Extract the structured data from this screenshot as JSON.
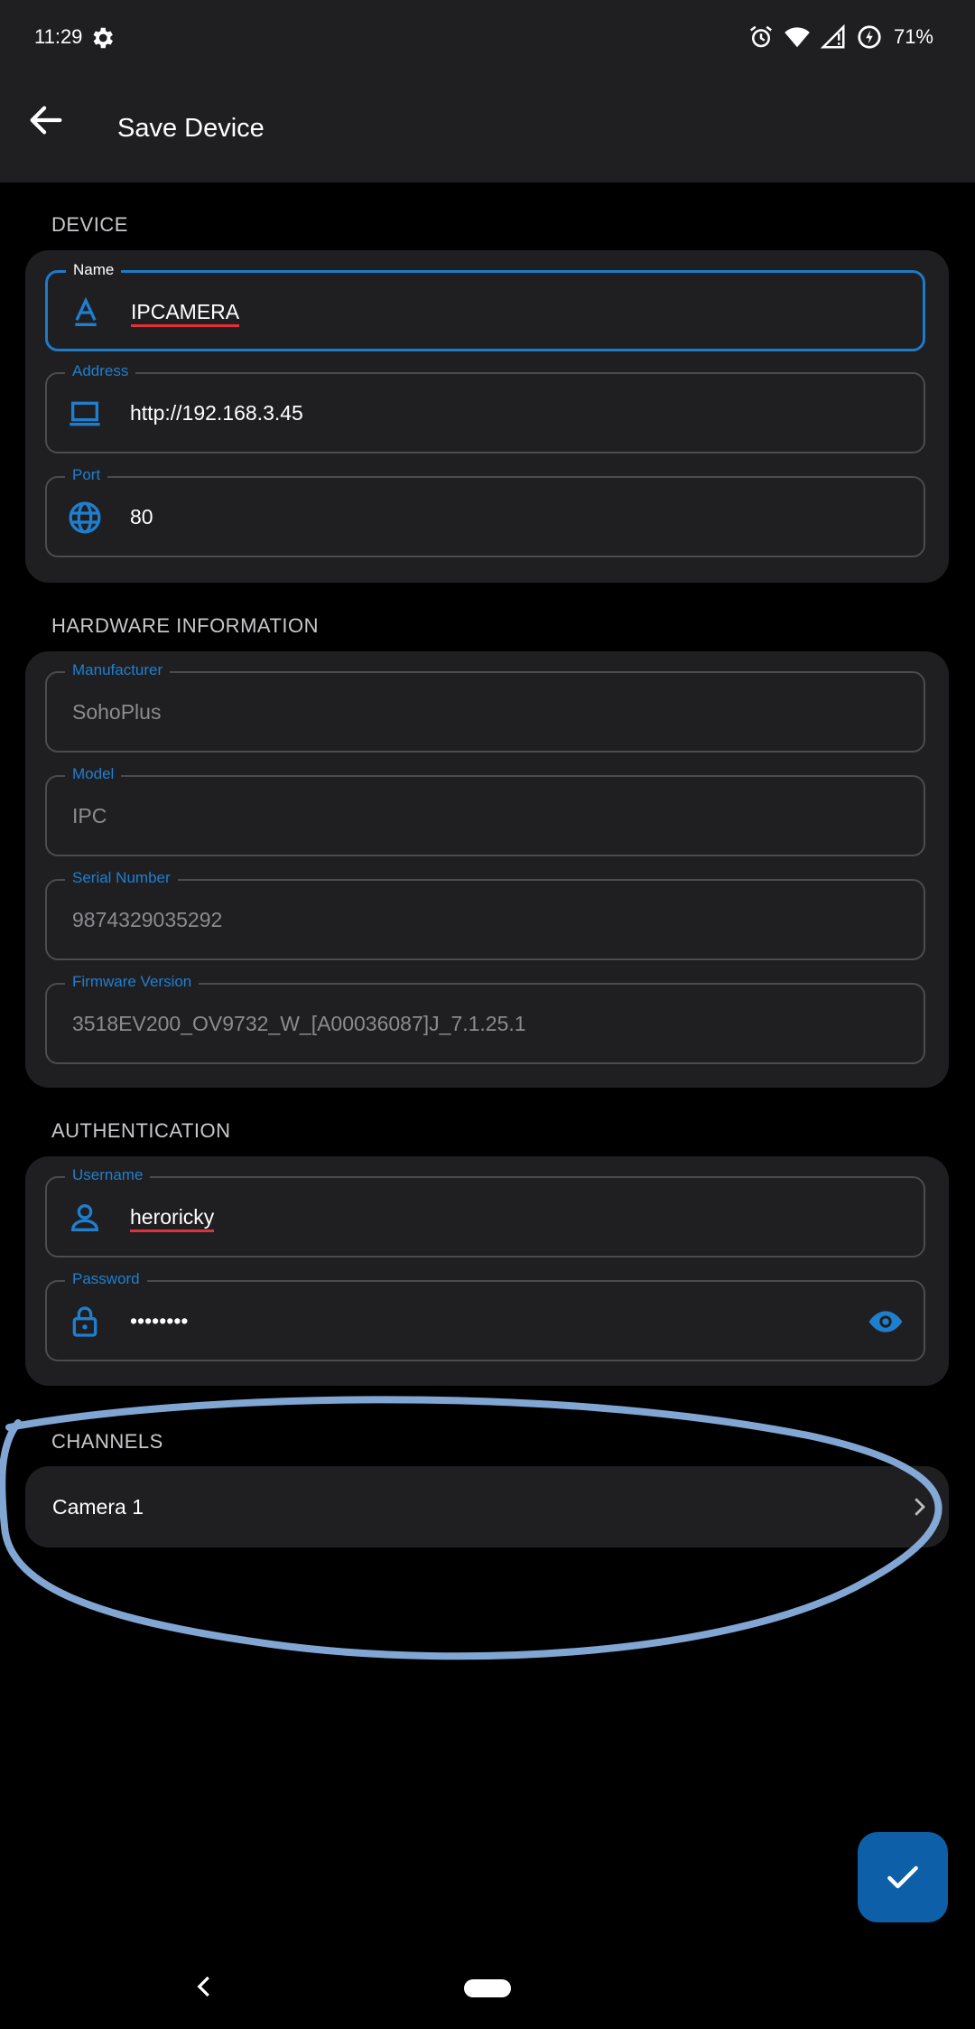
{
  "status": {
    "time": "11:29",
    "battery": "71%"
  },
  "appbar": {
    "title": "Save Device"
  },
  "sections": {
    "device": "DEVICE",
    "hardware": "HARDWARE INFORMATION",
    "auth": "AUTHENTICATION",
    "channels": "CHANNELS"
  },
  "device": {
    "name": {
      "label": "Name",
      "value": "IPCAMERA"
    },
    "address": {
      "label": "Address",
      "value": "http://192.168.3.45"
    },
    "port": {
      "label": "Port",
      "value": "80"
    }
  },
  "hardware": {
    "manufacturer": {
      "label": "Manufacturer",
      "value": "SohoPlus"
    },
    "model": {
      "label": "Model",
      "value": "IPC"
    },
    "serial": {
      "label": "Serial Number",
      "value": "9874329035292"
    },
    "firmware": {
      "label": "Firmware Version",
      "value": "3518EV200_OV9732_W_[A00036087]J_7.1.25.1"
    }
  },
  "auth": {
    "username": {
      "label": "Username",
      "value": "heroricky"
    },
    "password": {
      "label": "Password",
      "value": "••••••••"
    }
  },
  "channels": [
    {
      "label": "Camera 1"
    }
  ],
  "colors": {
    "accent": "#1f7fcf",
    "fab": "#0d5fa8",
    "surface": "#1f1f22",
    "annotation": "#8fb8ea"
  }
}
